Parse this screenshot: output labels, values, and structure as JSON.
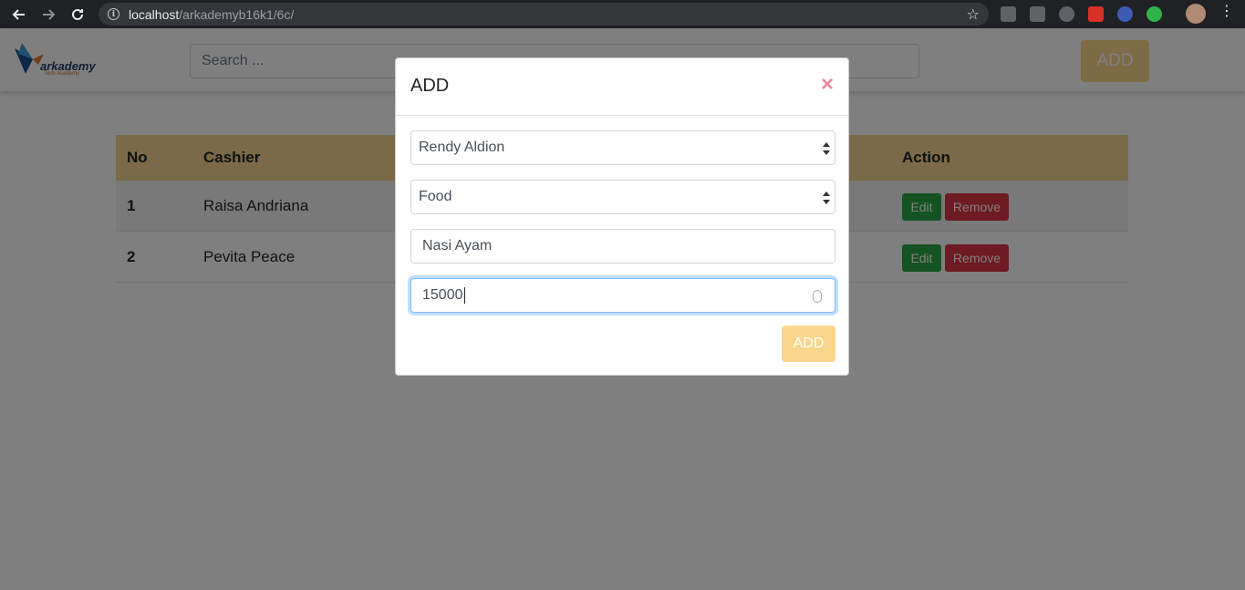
{
  "browser": {
    "url_host": "localhost",
    "url_path": "/arkademyb16k1/6c/"
  },
  "navbar": {
    "logo_text": "arkademy",
    "logo_sub": "Tech Academy",
    "search_placeholder": "Search ...",
    "add_label": "ADD"
  },
  "table": {
    "headers": {
      "no": "No",
      "cashier": "Cashier",
      "action": "Action"
    },
    "rows": [
      {
        "no": "1",
        "cashier": "Raisa Andriana",
        "edit": "Edit",
        "remove": "Remove"
      },
      {
        "no": "2",
        "cashier": "Pevita Peace",
        "edit": "Edit",
        "remove": "Remove"
      }
    ]
  },
  "modal": {
    "title": "ADD",
    "close": "×",
    "cashier_select": "Rendy Aldion",
    "category_select": "Food",
    "name_value": "Nasi Ayam",
    "price_value": "15000",
    "submit_label": "ADD"
  }
}
